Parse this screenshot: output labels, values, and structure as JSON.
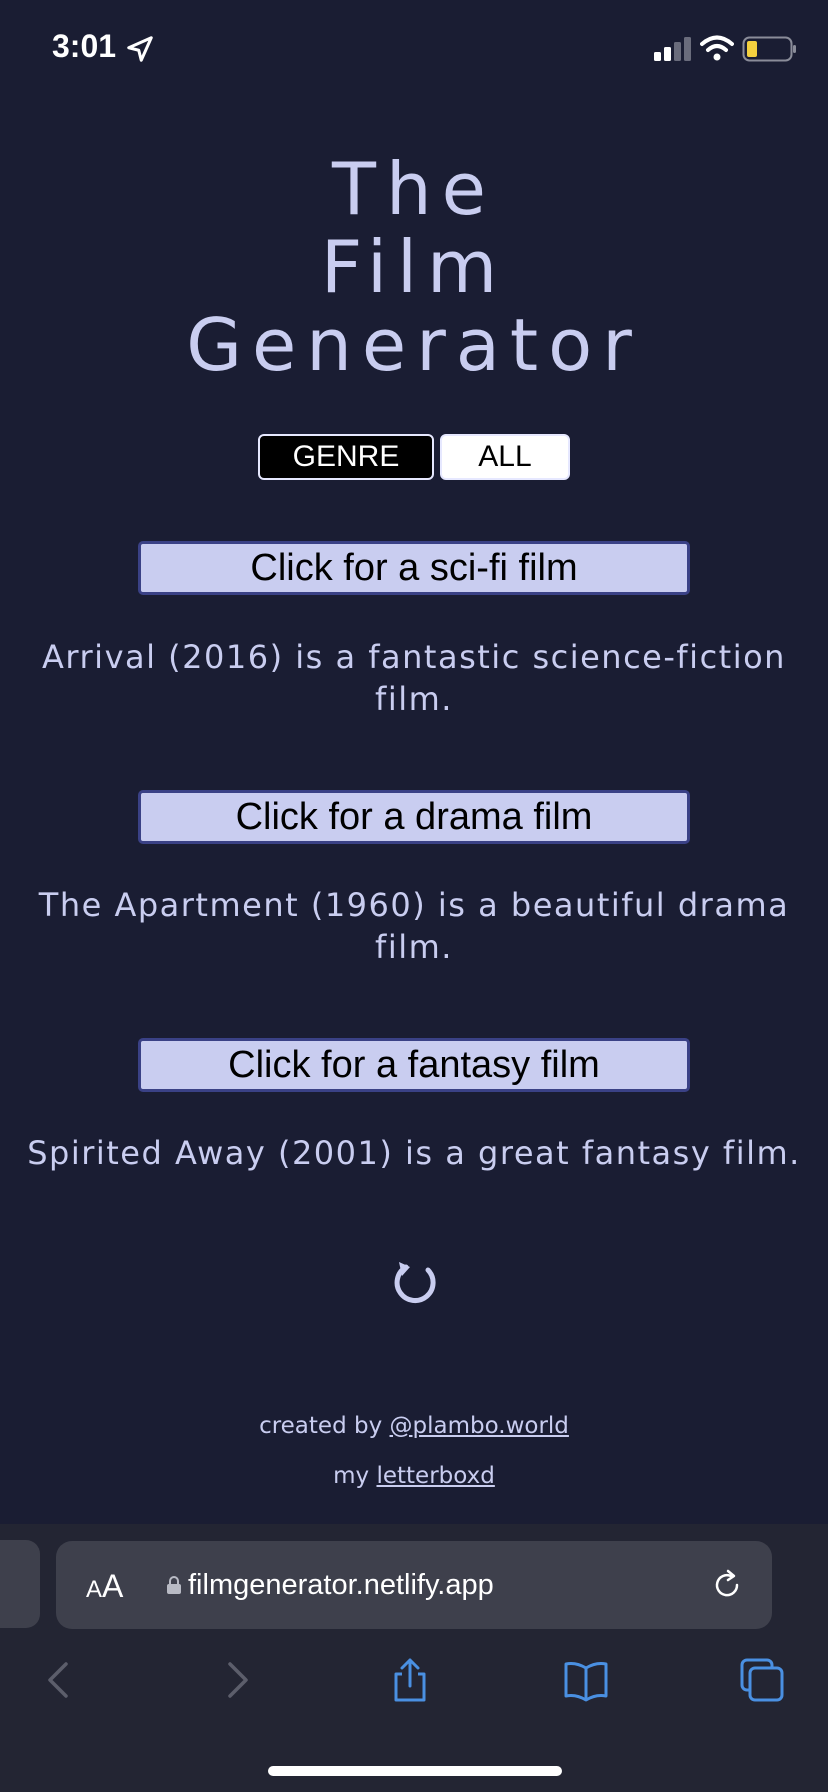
{
  "status_bar": {
    "time": "3:01"
  },
  "title": {
    "line1": "The",
    "line2": "Film",
    "line3": "Generator"
  },
  "toggle": {
    "genre_label": "GENRE",
    "all_label": "ALL"
  },
  "genres": [
    {
      "button_label": "Click for a sci-fi film",
      "result": "Arrival (2016) is a fantastic science-fiction film."
    },
    {
      "button_label": "Click for a drama film",
      "result": "The Apartment (1960) is a beautiful drama film."
    },
    {
      "button_label": "Click for a fantasy film",
      "result": "Spirited Away (2001) is a great fantasy film."
    }
  ],
  "reload_icon": "↻",
  "footer": {
    "created_by_prefix": "created by ",
    "created_by_link": "@plambo.world",
    "my_prefix": "my ",
    "letterboxd_link": "letterboxd"
  },
  "browser": {
    "text_size_small": "A",
    "text_size_big": "A",
    "url": "filmgenerator.netlify.app"
  },
  "colors": {
    "background": "#1a1d33",
    "accent": "#c9cdf0",
    "button_border": "#3a4186",
    "browser_bar": "#232533",
    "toolbar_icon": "#4a90e2"
  }
}
